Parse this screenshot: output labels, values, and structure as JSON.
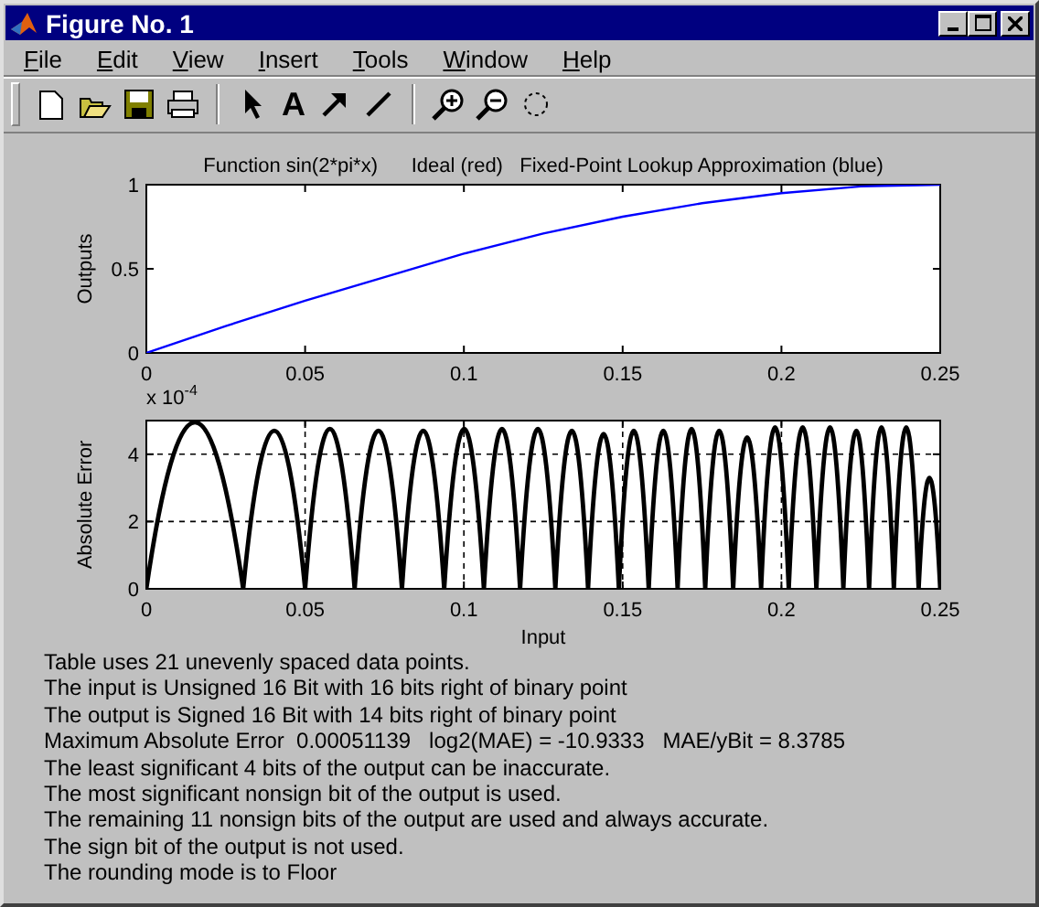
{
  "window": {
    "title": "Figure No. 1"
  },
  "menu": [
    {
      "label": "File"
    },
    {
      "label": "Edit"
    },
    {
      "label": "View"
    },
    {
      "label": "Insert"
    },
    {
      "label": "Tools"
    },
    {
      "label": "Window"
    },
    {
      "label": "Help"
    }
  ],
  "toolbar": {
    "text_tool": "A"
  },
  "plots": [
    {
      "chart_data": {
        "type": "line",
        "title": "Function sin(2*pi*x)      Ideal (red)   Fixed-Point Lookup Approximation (blue)",
        "ylabel": "Outputs",
        "x": [
          0,
          0.025,
          0.05,
          0.075,
          0.1,
          0.125,
          0.15,
          0.175,
          0.2,
          0.225,
          0.25
        ],
        "series": [
          {
            "color": "#0000ff",
            "values": [
              0,
              0.16,
              0.31,
              0.45,
              0.59,
              0.71,
              0.81,
              0.89,
              0.95,
              0.99,
              1
            ]
          }
        ],
        "xlim": [
          0,
          0.25
        ],
        "ylim": [
          0,
          1
        ],
        "xticks": [
          0,
          0.05,
          0.1,
          0.15,
          0.2,
          0.25
        ],
        "yticks": [
          0,
          0.5,
          1
        ]
      }
    },
    {
      "scale_label": "x 10$^{-4}$",
      "chart_data": {
        "type": "line",
        "grid": true,
        "xlabel": "Input",
        "ylabel": "Absolute Error",
        "x": [
          0,
          0.0153,
          0.0305,
          0.0403,
          0.05,
          0.0578,
          0.0656,
          0.0731,
          0.0805,
          0.0872,
          0.0938,
          0.1001,
          0.1063,
          0.112,
          0.1177,
          0.1233,
          0.1288,
          0.134,
          0.1391,
          0.144,
          0.1488,
          0.1535,
          0.1582,
          0.1628,
          0.1673,
          0.1717,
          0.176,
          0.1804,
          0.1848,
          0.1892,
          0.1936,
          0.198,
          0.2023,
          0.2067,
          0.211,
          0.2153,
          0.2195,
          0.2236,
          0.2276,
          0.2315,
          0.2354,
          0.2393,
          0.2432,
          0.2466,
          0.25
        ],
        "series": [
          {
            "color": "#000000",
            "values": [
              0,
              4.95,
              0,
              4.7,
              0,
              4.75,
              0,
              4.7,
              0,
              4.7,
              0,
              4.75,
              0,
              4.75,
              0,
              4.75,
              0,
              4.7,
              0,
              4.6,
              0,
              4.7,
              0,
              4.7,
              0,
              4.75,
              0,
              4.7,
              0,
              4.5,
              0,
              4.8,
              0,
              4.8,
              0,
              4.8,
              0,
              4.7,
              0,
              4.8,
              0,
              4.8,
              0,
              3.3,
              0
            ]
          }
        ],
        "xlim": [
          0,
          0.25
        ],
        "ylim": [
          0,
          5
        ],
        "xticks": [
          0,
          0.05,
          0.1,
          0.15,
          0.2,
          0.25
        ],
        "yticks": [
          0,
          2,
          4
        ]
      }
    }
  ],
  "info_lines": [
    "Table uses 21 unevenly spaced data points.",
    "The input is Unsigned 16 Bit with 16 bits right of binary point",
    "The output is Signed 16 Bit with 14 bits right of binary point",
    "Maximum Absolute Error  0.00051139   log2(MAE) = -10.9333   MAE/yBit = 8.3785",
    "The least significant 4 bits of the output can be inaccurate.",
    "The most significant nonsign bit of the output is used.",
    "The remaining 11 nonsign bits of the output are used and always accurate.",
    "The sign bit of the output is not used.",
    "The rounding mode is to Floor"
  ]
}
